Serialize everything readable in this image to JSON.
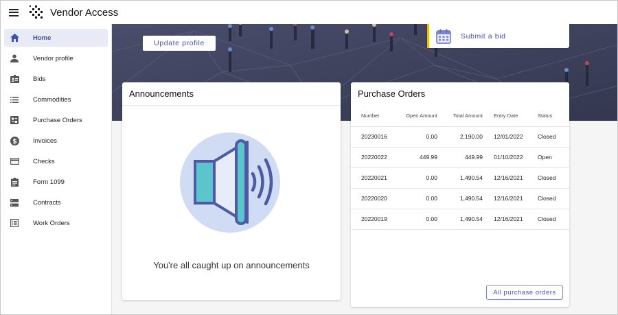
{
  "app": {
    "title": "Vendor Access"
  },
  "colors": {
    "accent": "#3f51b5",
    "bid_border": "#f0b90b",
    "hero_bg": "#3c3f5c",
    "active_bg": "#e8eaf6"
  },
  "sidebar": {
    "items": [
      {
        "label": "Home",
        "icon": "home-icon"
      },
      {
        "label": "Vendor profile",
        "icon": "person-icon"
      },
      {
        "label": "Bids",
        "icon": "badge-icon"
      },
      {
        "label": "Commodities",
        "icon": "list-icon"
      },
      {
        "label": "Purchase Orders",
        "icon": "receipt-icon"
      },
      {
        "label": "Invoices",
        "icon": "dollar-icon"
      },
      {
        "label": "Checks",
        "icon": "card-icon"
      },
      {
        "label": "Form 1099",
        "icon": "clipboard-icon"
      },
      {
        "label": "Contracts",
        "icon": "storage-icon"
      },
      {
        "label": "Work Orders",
        "icon": "list-alt-icon"
      }
    ],
    "active": "Home"
  },
  "hero": {
    "update_label": "Update profile",
    "bid_label": "Submit a bid"
  },
  "announcements": {
    "title": "Announcements",
    "empty_text": "You're all caught up on announcements"
  },
  "purchase_orders": {
    "title": "Purchase Orders",
    "columns": [
      "Number",
      "Open Amount",
      "Total Amount",
      "Entry Date",
      "Status"
    ],
    "rows": [
      [
        "20230016",
        "0.00",
        "2,190.00",
        "12/01/2022",
        "Closed"
      ],
      [
        "20220022",
        "449.99",
        "449.99",
        "01/10/2022",
        "Open"
      ],
      [
        "20220021",
        "0.00",
        "1,490.54",
        "12/16/2021",
        "Closed"
      ],
      [
        "20220020",
        "0.00",
        "1,490.54",
        "12/16/2021",
        "Closed"
      ],
      [
        "20220019",
        "0.00",
        "1,490.54",
        "12/16/2021",
        "Closed"
      ]
    ],
    "all_label": "All purchase orders"
  }
}
